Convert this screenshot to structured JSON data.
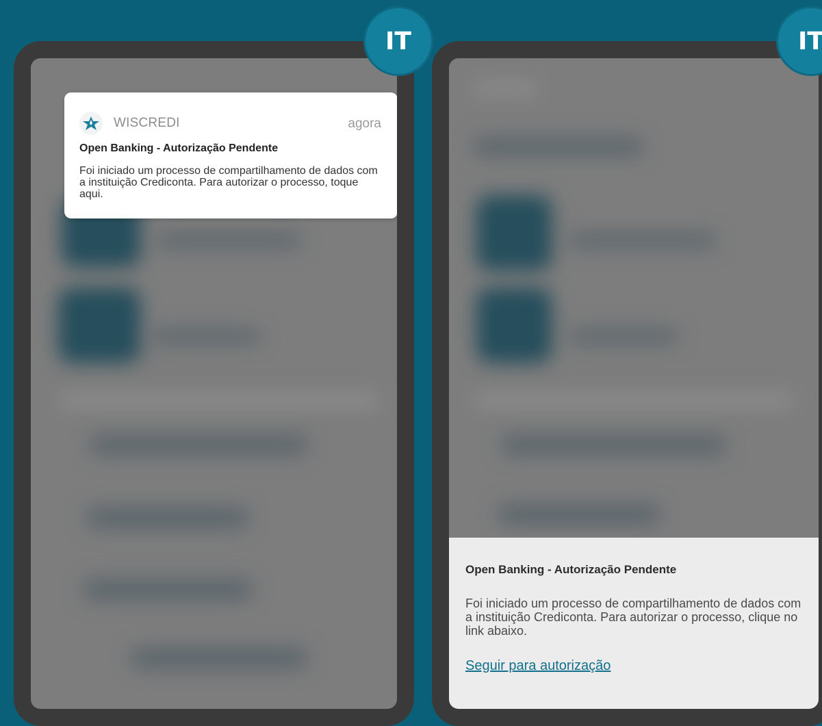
{
  "badges": {
    "left_label": "IT",
    "right_label": "IT"
  },
  "notification": {
    "app_name": "WISCREDI",
    "time": "agora",
    "title": "Open Banking - Autorização Pendente",
    "body": "Foi iniciado um processo de compartilhamento de dados com a instituição Crediconta. Para autorizar o processo, toque aqui.",
    "logo_icon": "wiscredi-star-icon"
  },
  "sheet": {
    "title": "Open Banking - Autorização Pendente",
    "body": "Foi iniciado um processo de compartilhamento de dados com a instituição Crediconta. Para autorizar o processo, clique no link abaixo.",
    "link_label": "Seguir para autorização"
  },
  "colors": {
    "background": "#0b6079",
    "badge": "#13809e",
    "link": "#12708c"
  }
}
